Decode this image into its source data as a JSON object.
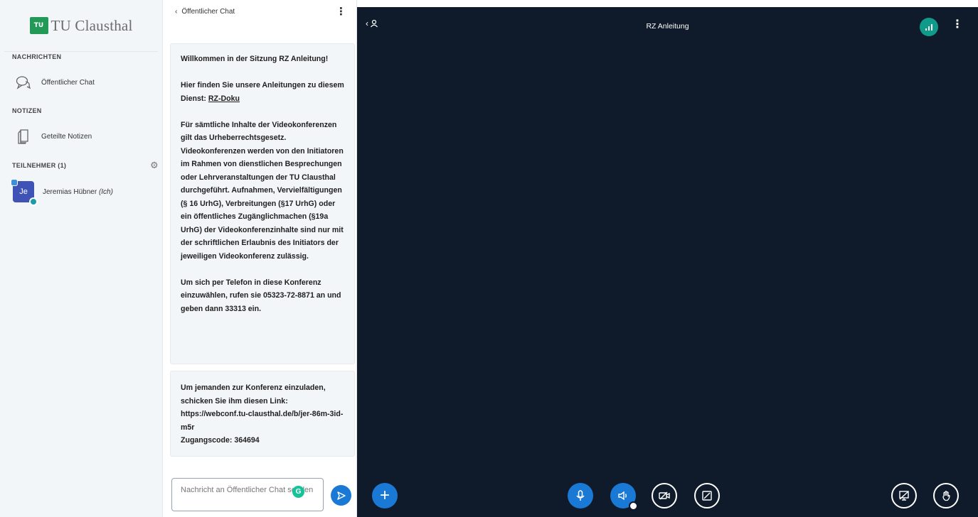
{
  "sidebar": {
    "logo_text": "TU Clausthal",
    "logo_mark": "tu-logo",
    "messages_title": "NACHRICHTEN",
    "public_chat_label": "Öffentlicher Chat",
    "notes_title": "NOTIZEN",
    "shared_notes_label": "Geteilte Notizen",
    "participants_title": "TEILNEHMER (1)",
    "user": {
      "initials": "Je",
      "name": "Jeremias Hübner",
      "self_tag": "(Ich)"
    }
  },
  "chat": {
    "header_title": "Öffentlicher Chat",
    "welcome": "Willkommen in der Sitzung RZ Anleitung!",
    "guide_text": "Hier finden Sie unsere Anleitungen zu diesem Dienst: ",
    "guide_link": "RZ-Doku",
    "copyright_text": "Für sämtliche Inhalte der Videokonferenzen gilt das Urheberrechtsgesetz. Videokonferenzen werden von den Initiatoren im Rahmen von dienstlichen Besprechungen oder Lehrveranstaltungen der TU Clausthal durchgeführt. Aufnahmen, Vervielfältigungen (§ 16 UrhG), Verbreitungen (§17 UrhG) oder ein öffentliches Zugänglichmachen (§19a UrhG) der Videokonferenzinhalte sind nur mit der schriftlichen Erlaubnis des Initiators der jeweiligen Videokonferenz zulässig.",
    "phone_text": "Um sich per Telefon in diese Konferenz einzuwählen, rufen sie 05323-72-8871 an und geben dann 33313 ein.",
    "invite_text": "Um jemanden zur Konferenz einzuladen, schicken Sie ihm diesen Link:",
    "invite_link": "https://webconf.tu-clausthal.de/b/jer-86m-3id-m5r",
    "access_code": "Zugangscode: 364694",
    "input_placeholder": "Nachricht an Öffentlicher Chat senden"
  },
  "main": {
    "title": "RZ Anleitung"
  },
  "icons": [
    "chevron-left-icon",
    "kebab-icon",
    "chat-bubble-icon",
    "notes-icon",
    "gear-icon",
    "send-icon",
    "user-list-icon",
    "connection-icon",
    "plus-icon",
    "microphone-icon",
    "audio-icon",
    "camera-icon",
    "screenshare-icon",
    "presentation-icon",
    "hand-icon"
  ],
  "colors": {
    "main_bg": "#0f1b2a",
    "accent_blue": "#1b79d6",
    "brand_green": "#239957",
    "connection_teal": "#0f9a8a"
  }
}
